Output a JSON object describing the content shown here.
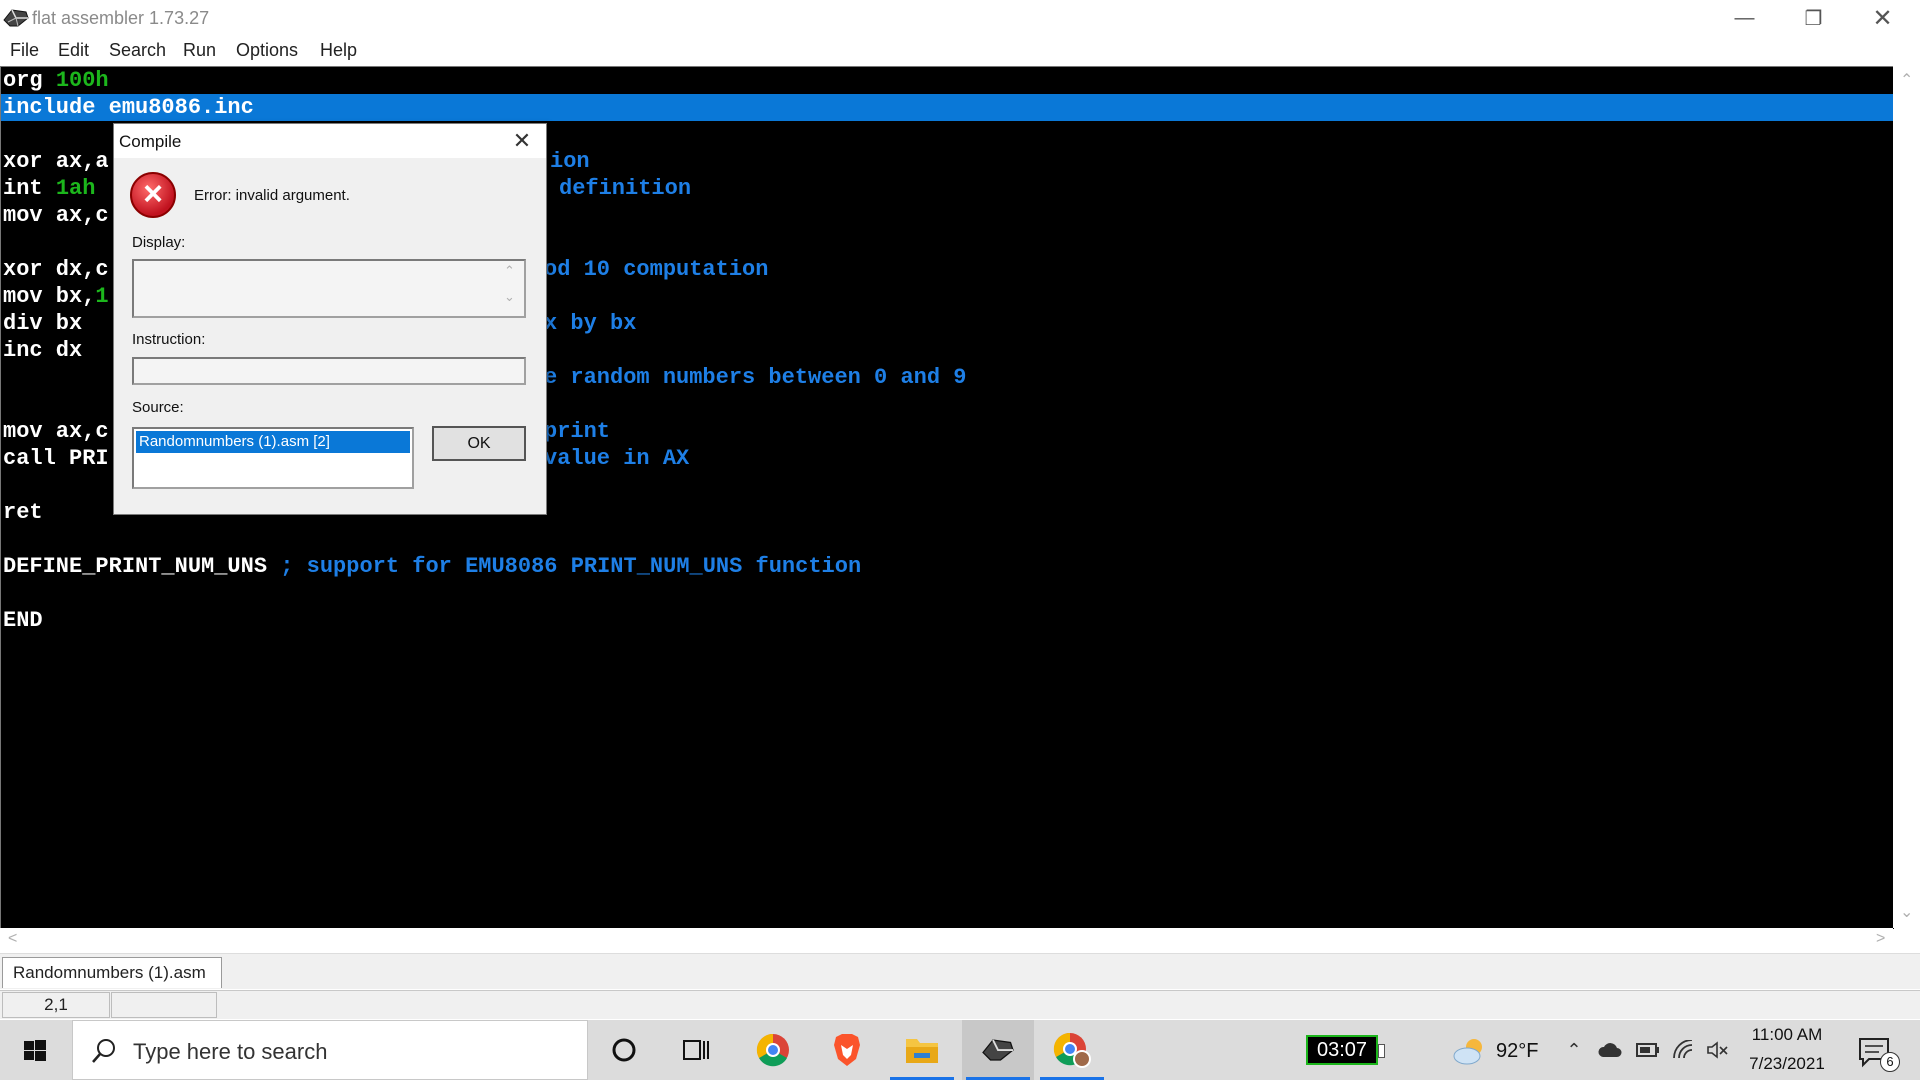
{
  "window": {
    "title": "flat assembler 1.73.27"
  },
  "menu": [
    "File",
    "Edit",
    "Search",
    "Run",
    "Options",
    "Help"
  ],
  "editor": {
    "lines": [
      {
        "code": "org ",
        "num": "100h",
        "comment": ""
      },
      {
        "code": "include emu8086.inc",
        "num": "",
        "comment": ""
      },
      {
        "code": "",
        "num": "",
        "comment": ""
      },
      {
        "code": "xor ax,a",
        "num": "",
        "comment": "ion"
      },
      {
        "code": "int ",
        "num": "1ah",
        "comment": "definition"
      },
      {
        "code": "mov ax,c",
        "num": "",
        "comment": ""
      },
      {
        "code": "",
        "num": "",
        "comment": ""
      },
      {
        "code": "xor dx,c",
        "num": "",
        "comment": "od 10 computation"
      },
      {
        "code": "mov bx,",
        "num": "1",
        "comment": ""
      },
      {
        "code": "div bx",
        "num": "",
        "comment": "x by bx"
      },
      {
        "code": "inc dx",
        "num": "",
        "comment": ""
      },
      {
        "code": "",
        "num": "",
        "comment": "e random numbers between 0 and 9"
      },
      {
        "code": "",
        "num": "",
        "comment": ""
      },
      {
        "code": "mov ax,c",
        "num": "",
        "comment": "print"
      },
      {
        "code": "call PRI",
        "num": "",
        "comment": "value in AX"
      },
      {
        "code": "",
        "num": "",
        "comment": ""
      },
      {
        "code": "ret",
        "num": "",
        "comment": ""
      },
      {
        "code": "",
        "num": "",
        "comment": ""
      },
      {
        "code": "DEFINE_PRINT_NUM_UNS ",
        "num": "",
        "comment": "; support for EMU8086 PRINT_NUM_UNS function"
      },
      {
        "code": "",
        "num": "",
        "comment": ""
      },
      {
        "code": "END",
        "num": "",
        "comment": ""
      }
    ],
    "selected_line": 2
  },
  "tabs": {
    "active": "Randomnumbers (1).asm"
  },
  "status": {
    "position": "2,1",
    "cell2": ""
  },
  "dialog": {
    "title": "Compile",
    "error": "Error: invalid argument.",
    "display_label": "Display:",
    "display_value": "",
    "instruction_label": "Instruction:",
    "instruction_value": "",
    "source_label": "Source:",
    "source_items": [
      "Randomnumbers (1).asm [2]"
    ],
    "ok_label": "OK"
  },
  "taskbar": {
    "search_placeholder": "Type here to search",
    "timer": "03:07",
    "temperature": "92°F",
    "time": "11:00 AM",
    "date": "7/23/2021",
    "notification_count": "6",
    "accent": "#1a73e8"
  },
  "colors": {
    "editor_bg": "#000000",
    "code_text": "#ffffff",
    "number_text": "#1cb61c",
    "comment_text": "#1e7fe6",
    "selection": "#0a78d7"
  }
}
